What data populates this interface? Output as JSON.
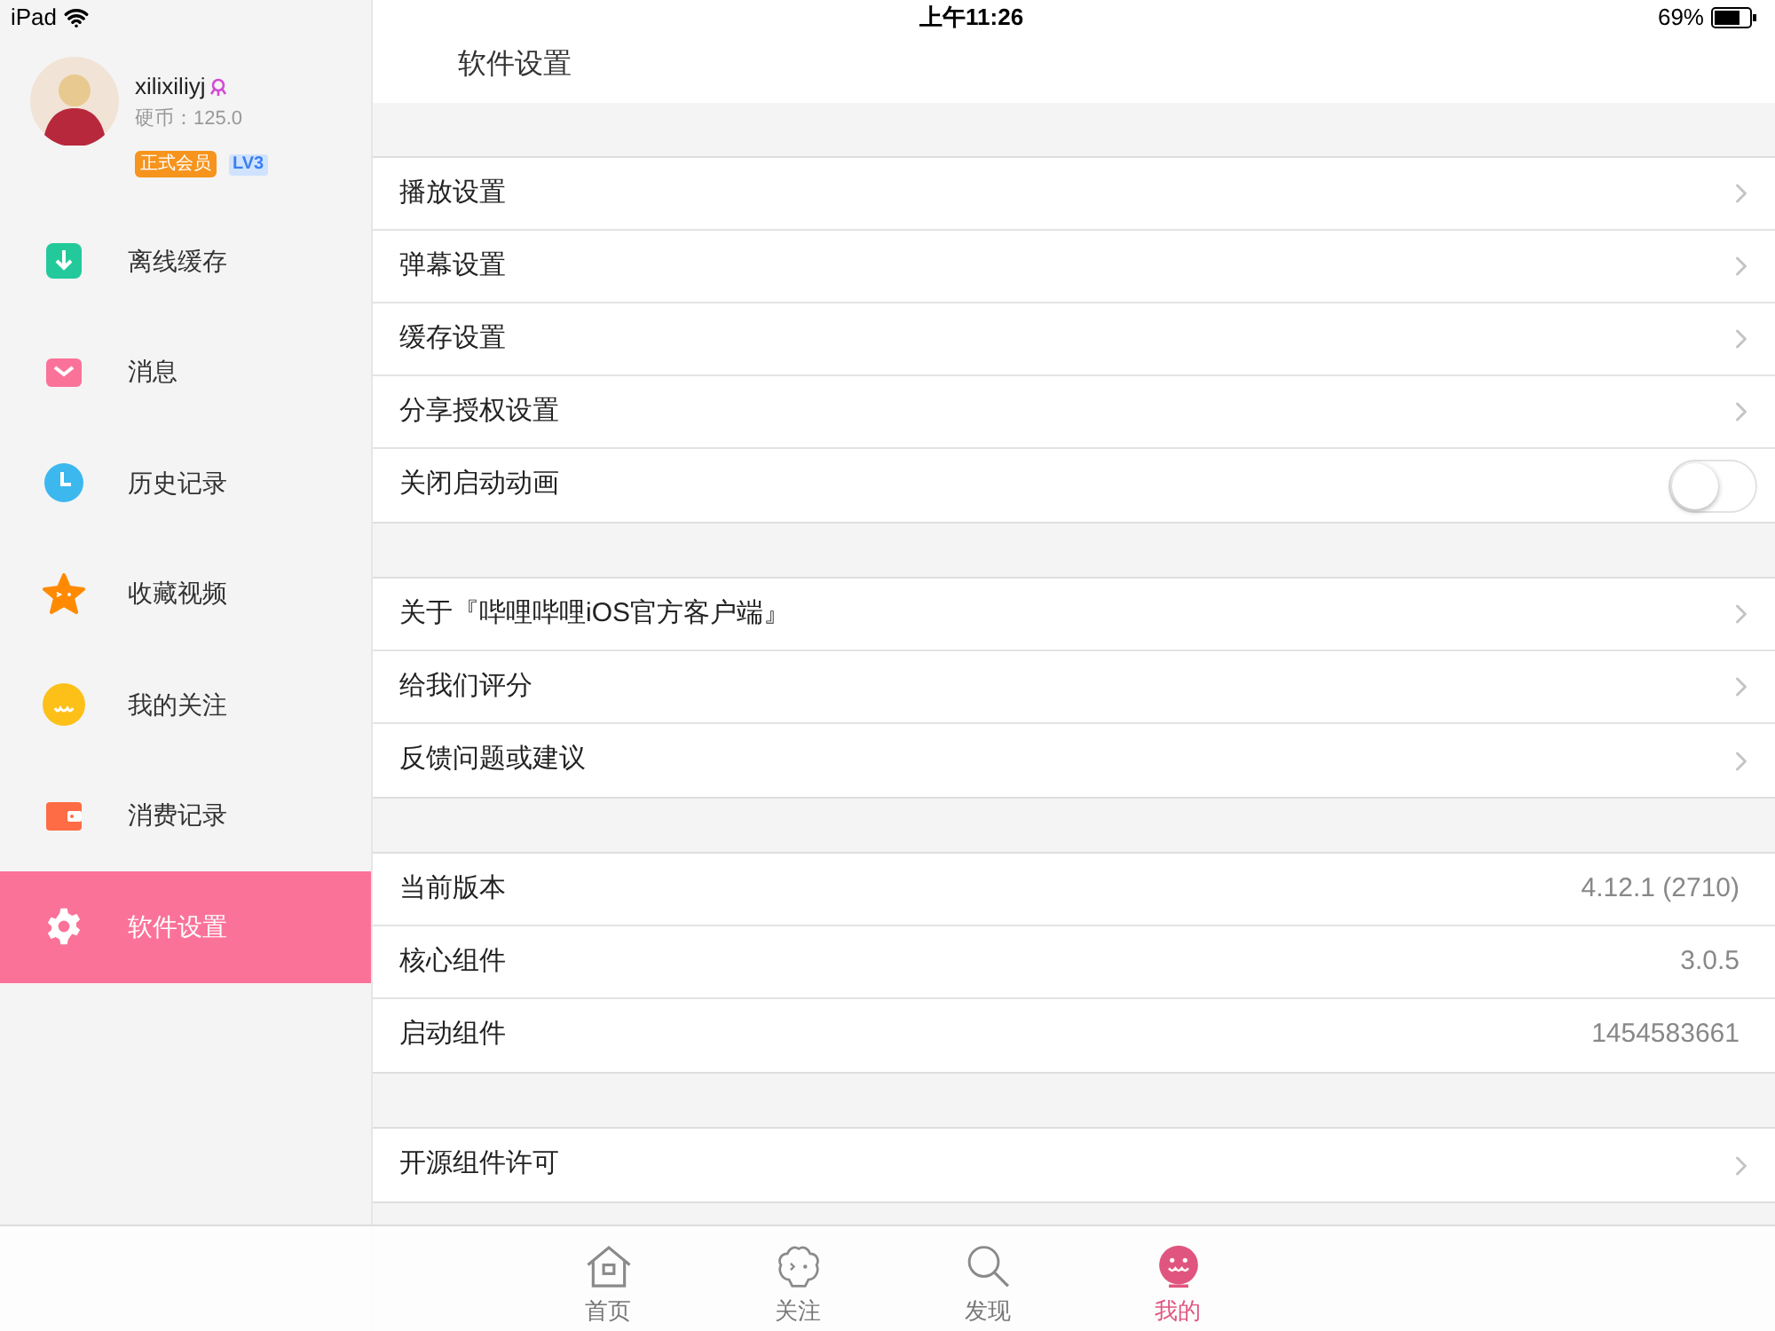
{
  "status_bar": {
    "device": "iPad",
    "time": "上午11:26",
    "battery": "69%"
  },
  "profile": {
    "name": "xilixiliyj",
    "coins": "硬币：125.0",
    "badge": "正式会员",
    "level": "LV3"
  },
  "sidebar": {
    "items": [
      {
        "label": "离线缓存",
        "kind": "download",
        "selected": false
      },
      {
        "label": "消息",
        "kind": "mail",
        "selected": false
      },
      {
        "label": "历史记录",
        "kind": "clock",
        "selected": false
      },
      {
        "label": "收藏视频",
        "kind": "star",
        "selected": false
      },
      {
        "label": "我的关注",
        "kind": "smile",
        "selected": false
      },
      {
        "label": "消费记录",
        "kind": "wallet",
        "selected": false
      },
      {
        "label": "软件设置",
        "kind": "gear",
        "selected": true
      }
    ]
  },
  "header": {
    "title": "软件设置"
  },
  "groups": [
    {
      "rows": [
        {
          "kind": "link",
          "label": "播放设置"
        },
        {
          "kind": "link",
          "label": "弹幕设置"
        },
        {
          "kind": "link",
          "label": "缓存设置"
        },
        {
          "kind": "link",
          "label": "分享授权设置"
        },
        {
          "kind": "toggle",
          "label": "关闭启动动画",
          "on": false
        }
      ]
    },
    {
      "rows": [
        {
          "kind": "link",
          "label": "关于『哔哩哔哩iOS官方客户端』"
        },
        {
          "kind": "link",
          "label": "给我们评分"
        },
        {
          "kind": "link",
          "label": "反馈问题或建议"
        }
      ]
    },
    {
      "rows": [
        {
          "kind": "value",
          "label": "当前版本",
          "value": "4.12.1 (2710)"
        },
        {
          "kind": "value",
          "label": "核心组件",
          "value": "3.0.5"
        },
        {
          "kind": "value",
          "label": "启动组件",
          "value": "1454583661"
        }
      ]
    },
    {
      "rows": [
        {
          "kind": "link",
          "label": "开源组件许可"
        }
      ]
    }
  ],
  "tab_bar": [
    {
      "label": "首页",
      "kind": "home",
      "selected": false
    },
    {
      "label": "关注",
      "kind": "face",
      "selected": false
    },
    {
      "label": "发现",
      "kind": "search",
      "selected": false
    },
    {
      "label": "我的",
      "kind": "me",
      "selected": true
    }
  ]
}
